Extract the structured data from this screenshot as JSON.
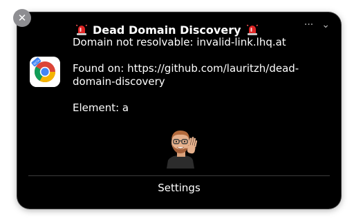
{
  "notification": {
    "title": "Dead Domain Discovery",
    "lines": {
      "domain": "Domain not resolvable: invalid-link.lhq.at",
      "found_on": "Found on: https://github.com/lauritzh/dead-domain-discovery",
      "element": "Element: a"
    },
    "settings_label": "Settings",
    "close_glyph": "✕",
    "more_glyph": "···",
    "collapse_glyph": "⌄"
  },
  "icons": {
    "app": "chrome-beta-icon",
    "title_prefix": "siren-icon",
    "title_suffix": "siren-icon",
    "avatar": "memoji-waving-icon"
  },
  "app_icon_badge": "BETA",
  "colors": {
    "background": "#000000",
    "text": "#ffffff",
    "close_button": "#8e8e92",
    "divider": "#3c3c3c"
  }
}
